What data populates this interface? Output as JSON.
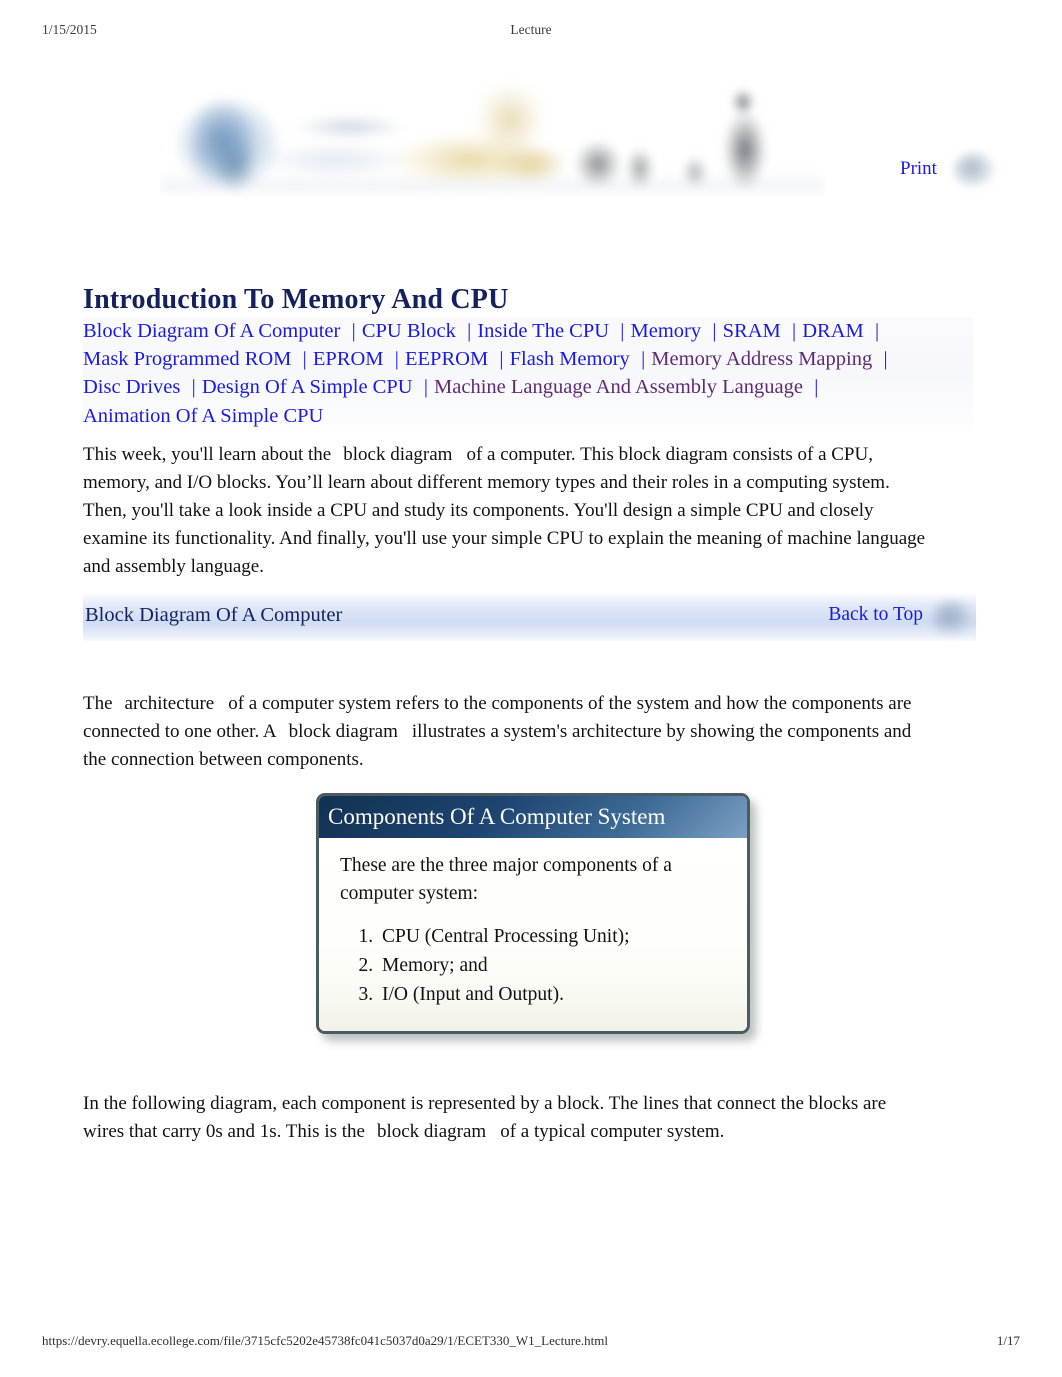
{
  "page_header": {
    "date": "1/15/2015",
    "title": "Lecture"
  },
  "banner": {
    "alt": "course banner image"
  },
  "print": {
    "label": "Print",
    "icon": "print-blob-icon"
  },
  "main_title": "Introduction To Memory And CPU",
  "nav_links": [
    {
      "label": "Block Diagram Of A Computer",
      "visited": false
    },
    {
      "label": "CPU Block",
      "visited": false
    },
    {
      "label": "Inside The CPU",
      "visited": false
    },
    {
      "label": "Memory",
      "visited": false
    },
    {
      "label": "SRAM",
      "visited": false
    },
    {
      "label": "DRAM",
      "visited": false
    },
    {
      "label": "Mask Programmed ROM",
      "visited": false
    },
    {
      "label": "EPROM",
      "visited": false
    },
    {
      "label": "EEPROM",
      "visited": false
    },
    {
      "label": "Flash Memory",
      "visited": false
    },
    {
      "label": "Memory Address Mapping",
      "visited": true
    },
    {
      "label": "Disc Drives",
      "visited": false
    },
    {
      "label": "Design Of A Simple CPU",
      "visited": false
    },
    {
      "label": "Machine Language And Assembly Language",
      "visited": true
    },
    {
      "label": "Animation Of A Simple CPU",
      "visited": false
    }
  ],
  "nav_separator": "|",
  "paragraphs": {
    "intro_a": "This week, you'll learn about the",
    "intro_term": "block diagram",
    "intro_b": "of a computer. This block diagram consists of a CPU, memory, and I/O blocks. You’ll learn about different memory types and their roles in a computing system. Then, you'll take a look inside a CPU and study its components. You'll design a simple CPU and closely examine its functionality. And finally, you'll use your simple CPU to explain the meaning of machine language and assembly language.",
    "arch_a": "The",
    "arch_term1": "architecture",
    "arch_b": "of a computer system refers to the components of the system and how the components are connected to one other. A",
    "arch_term2": "block diagram",
    "arch_c": "illustrates a system's architecture by showing the components and the connection between components.",
    "final_a": "In the following diagram, each component is represented by a block. The lines that connect the blocks are wires that carry 0s and 1s. This is the",
    "final_term": "block diagram",
    "final_b": "of a typical computer system."
  },
  "section_bar": {
    "title": "Block Diagram Of A Computer",
    "back_to_top": "Back to Top",
    "icon": "back-to-top-blob-icon"
  },
  "callout": {
    "header": "Components Of A Computer System",
    "intro": "These are the three major components of a computer system:",
    "items": [
      "CPU (Central Processing Unit);",
      "Memory;  and",
      "I/O (Input and Output)."
    ]
  },
  "page_footer": {
    "url": "https://devry.equella.ecollege.com/file/3715cfc5202e45738fc041c5037d0a29/1/ECET330_W1_Lecture.html",
    "page": "1/17"
  },
  "colors": {
    "link": "#1a1ae0",
    "visited_link": "#5f2a72",
    "heading": "#14215e",
    "callout_header_dark": "#123152",
    "callout_border": "#4a5c60",
    "section_bar": "#cfdcf3"
  }
}
